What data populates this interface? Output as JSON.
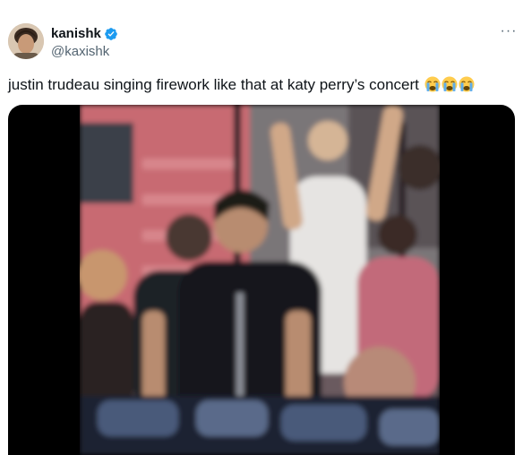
{
  "tweet": {
    "author": {
      "display_name": "kanishk",
      "handle": "@kaxishk",
      "verified": true,
      "avatar_icon": "avatar-photo"
    },
    "more_label": "···",
    "text": "justin trudeau singing firework like that at katy perry’s concert",
    "emojis": [
      "loudly-crying-face",
      "loudly-crying-face",
      "loudly-crying-face"
    ]
  },
  "media": {
    "type": "video-frame",
    "description_icon": "video-still"
  },
  "colors": {
    "verified_blue": "#1d9bf0",
    "handle_gray": "#536471",
    "text": "#0f1419"
  }
}
